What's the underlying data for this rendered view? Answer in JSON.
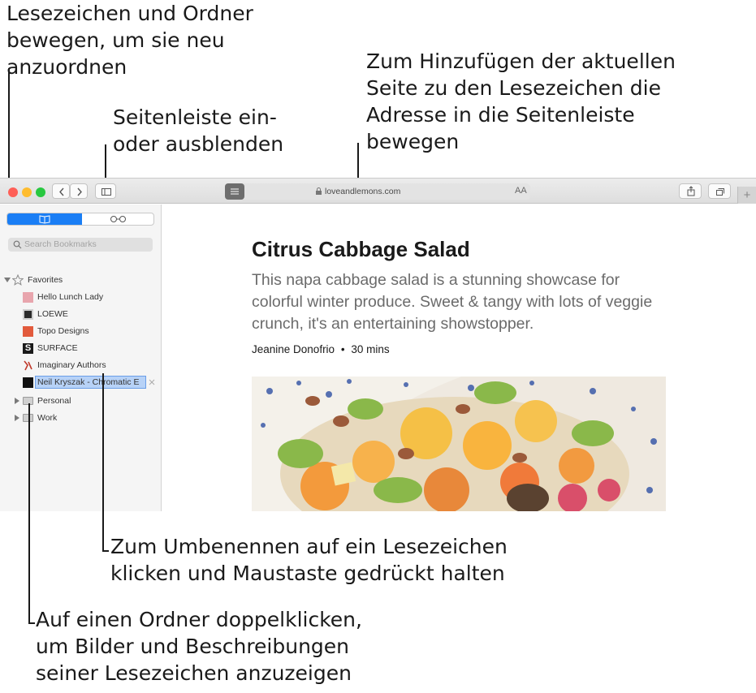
{
  "callouts": {
    "move": "Lesezeichen und Ordner\nbewegen, um sie neu\nanzuordnen",
    "add": "Zum Hinzufügen der aktuellen\nSeite zu den Lesezeichen die\nAdresse in die Seitenleiste\nbewegen",
    "sidebar_toggle": "Seitenleiste ein-\noder ausblenden",
    "rename": "Zum Umbenennen auf ein Lesezeichen\nklicken und Maustaste gedrückt halten",
    "folder": "Auf einen Ordner doppelklicken,\num Bilder und Beschreibungen\nseiner Lesezeichen anzuzeigen"
  },
  "browser": {
    "url": "loveandlemons.com",
    "text_size_label": "AA",
    "new_tab_label": "+"
  },
  "sidebar": {
    "search_placeholder": "Search Bookmarks",
    "favorites_label": "Favorites",
    "bookmarks": [
      {
        "label": "Hello Lunch Lady"
      },
      {
        "label": "LOEWE"
      },
      {
        "label": "Topo Designs"
      },
      {
        "label": "SURFACE"
      },
      {
        "label": "Imaginary Authors"
      },
      {
        "label": "Neil Kryszak - Chromatic E"
      }
    ],
    "folders": [
      {
        "label": "Personal"
      },
      {
        "label": "Work"
      }
    ]
  },
  "article": {
    "title": "Citrus Cabbage Salad",
    "description": "This napa cabbage salad is a stunning showcase for colorful winter produce. Sweet & tangy with lots of veggie crunch, it's an entertaining showstopper.",
    "author": "Jeanine Donofrio",
    "separator": "•",
    "duration": "30 mins"
  },
  "colors": {
    "close": "#fe5f57",
    "minimize": "#febc2e",
    "zoom": "#28c840",
    "accent": "#1a7ef5",
    "selection": "#b7d2f7"
  }
}
